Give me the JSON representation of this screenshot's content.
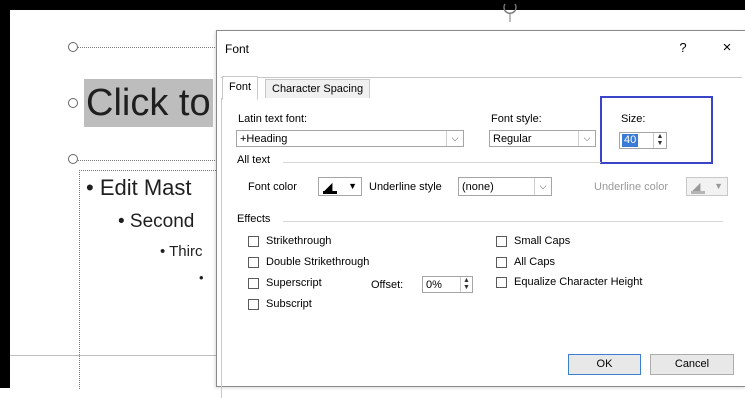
{
  "slide": {
    "title_placeholder": "Click to",
    "levels": [
      "• Edit Mast",
      "• Second",
      "• Thirc",
      "•"
    ]
  },
  "dialog": {
    "title": "Font",
    "help_label": "?",
    "close_label": "×",
    "tabs": {
      "font": "Font",
      "character_spacing": "Character Spacing"
    },
    "latin_text_font": {
      "label": "Latin text font:",
      "value": "+Heading"
    },
    "font_style": {
      "label": "Font style:",
      "value": "Regular"
    },
    "size": {
      "label": "Size:",
      "value": "40"
    },
    "all_text": {
      "heading": "All text",
      "font_color_label": "Font color",
      "underline_style_label": "Underline style",
      "underline_style_value": "(none)",
      "underline_color_label": "Underline color"
    },
    "effects": {
      "heading": "Effects",
      "strikethrough": "Strikethrough",
      "double_strikethrough": "Double Strikethrough",
      "superscript": "Superscript",
      "subscript": "Subscript",
      "offset_label": "Offset:",
      "offset_value": "0%",
      "small_caps": "Small Caps",
      "all_caps": "All Caps",
      "equalize_height": "Equalize Character Height"
    },
    "buttons": {
      "ok": "OK",
      "cancel": "Cancel"
    }
  },
  "colors": {
    "highlight_box": "#3b44c8",
    "selection": "#3a7bd5"
  }
}
